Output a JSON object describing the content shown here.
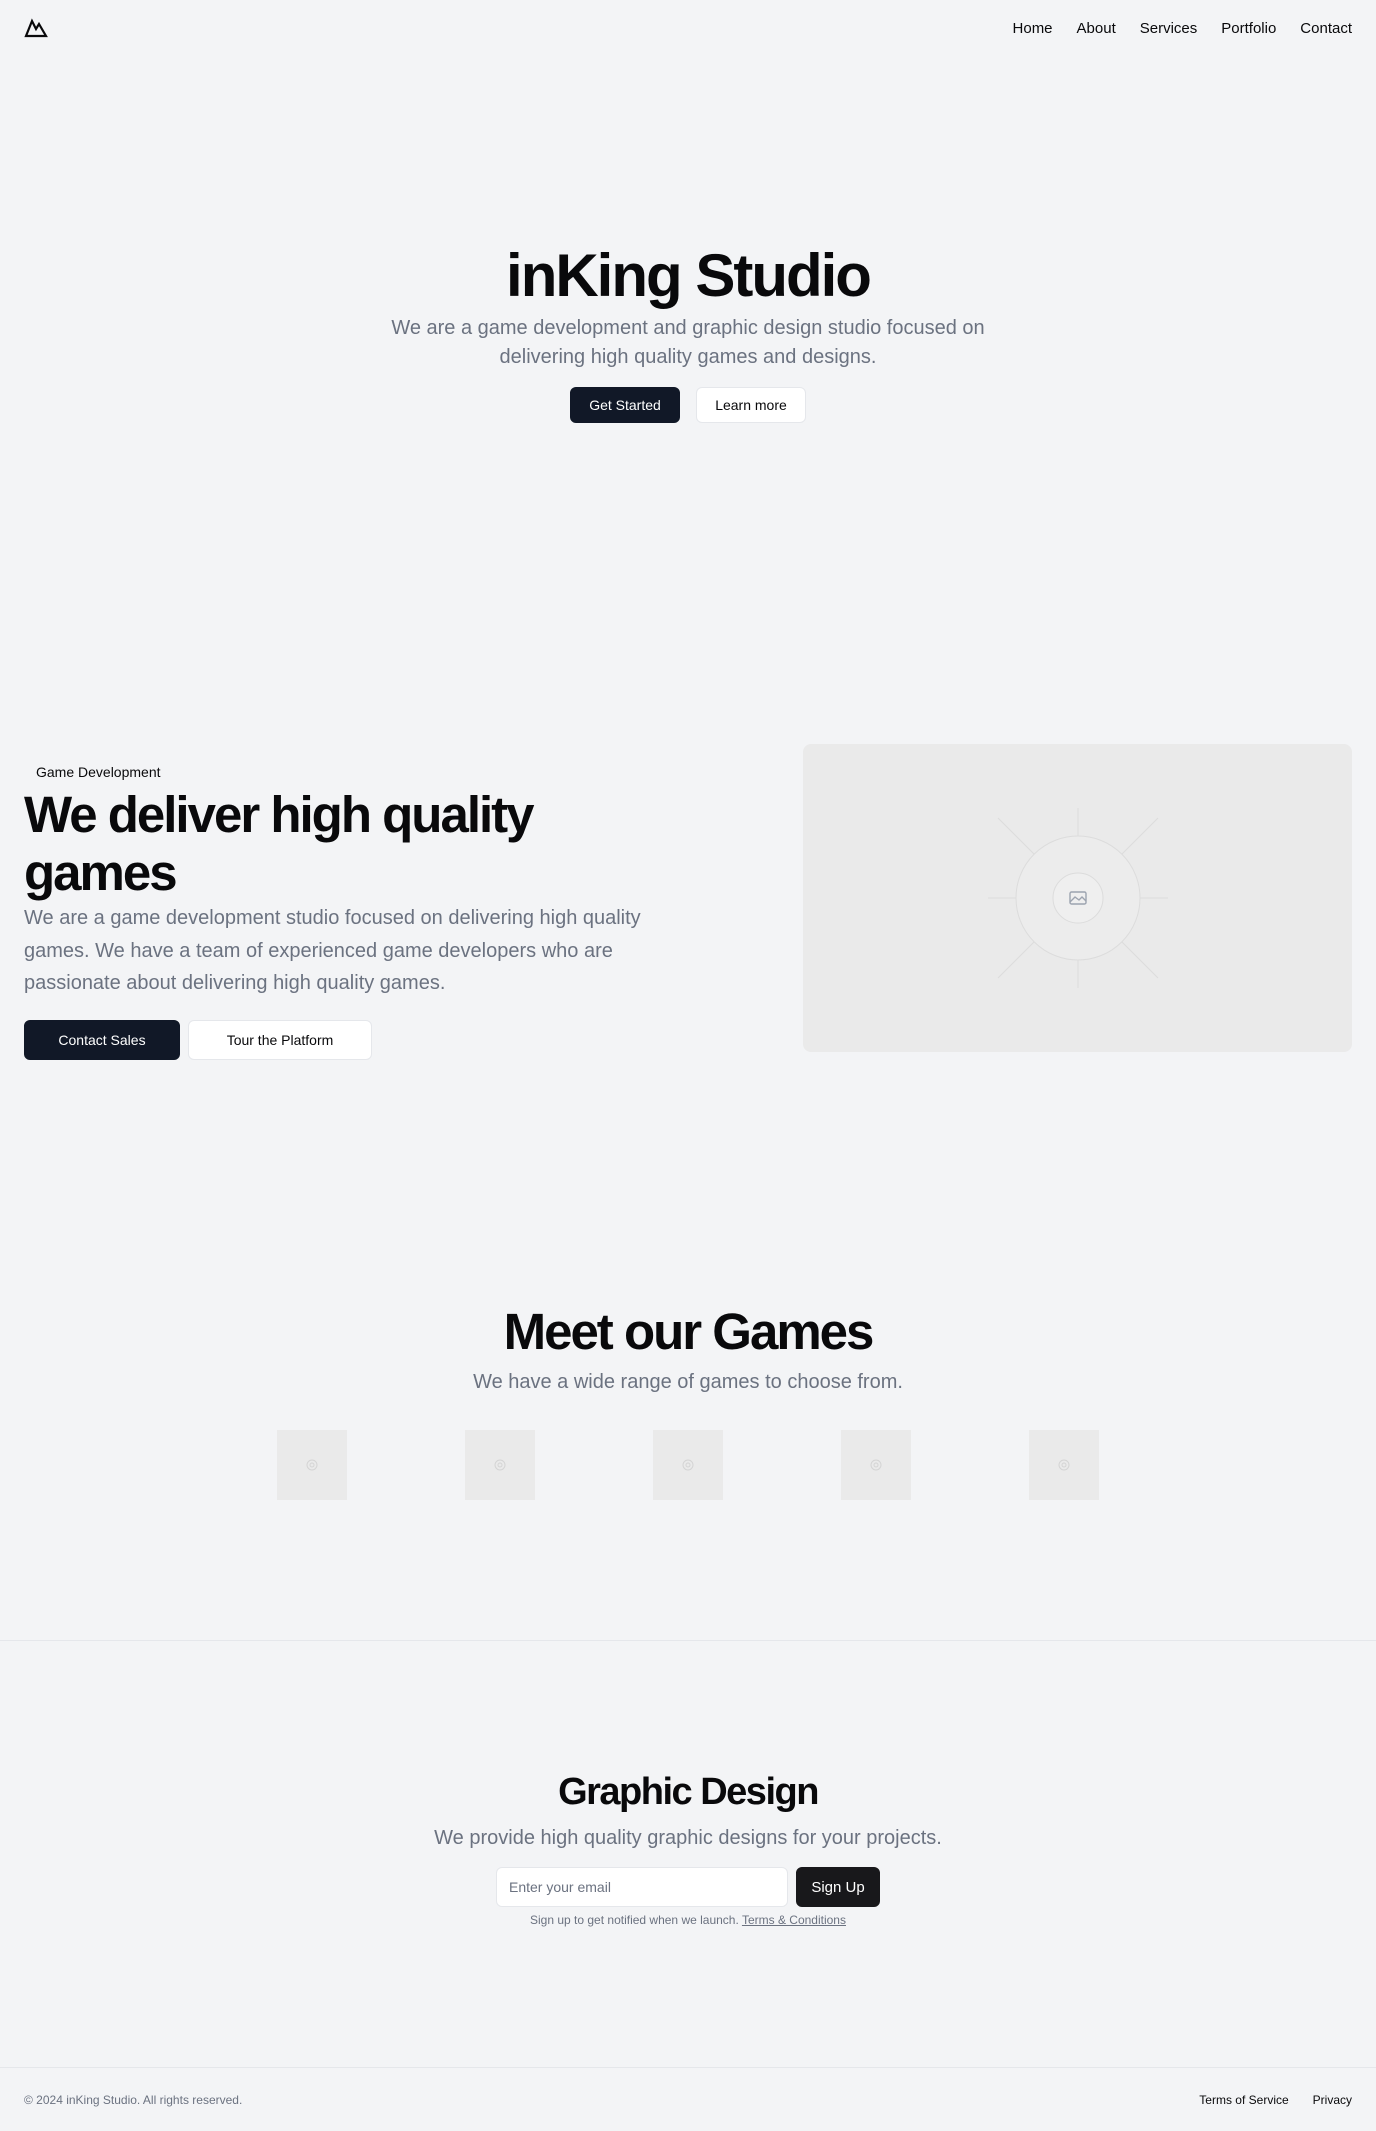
{
  "header": {
    "logo_icon": "mountain-icon",
    "nav": [
      {
        "label": "Home"
      },
      {
        "label": "About"
      },
      {
        "label": "Services"
      },
      {
        "label": "Portfolio"
      },
      {
        "label": "Contact"
      }
    ]
  },
  "hero": {
    "title": "inKing Studio",
    "subtitle": "We are a game development and graphic design studio focused on delivering high quality games and designs.",
    "primary_button": "Get Started",
    "secondary_button": "Learn more"
  },
  "feature": {
    "badge": "Game Development",
    "title": "We deliver high quality games",
    "text": "We are a game development studio focused on delivering high quality games. We have a team of experienced game developers who are passionate about delivering high quality games.",
    "primary_button": "Contact Sales",
    "secondary_button": "Tour the Platform",
    "image_icon": "image-placeholder-icon"
  },
  "games": {
    "title": "Meet our Games",
    "subtitle": "We have a wide range of games to choose from.",
    "thumbnails": [
      {
        "icon": "image-placeholder-icon"
      },
      {
        "icon": "image-placeholder-icon"
      },
      {
        "icon": "image-placeholder-icon"
      },
      {
        "icon": "image-placeholder-icon"
      },
      {
        "icon": "image-placeholder-icon"
      }
    ]
  },
  "design": {
    "title": "Graphic Design",
    "subtitle": "We provide high quality graphic designs for your projects.",
    "email_placeholder": "Enter your email",
    "signup_button": "Sign Up",
    "note": "Sign up to get notified when we launch.",
    "terms_link": "Terms & Conditions"
  },
  "footer": {
    "copyright": "© 2024 inKing Studio. All rights reserved.",
    "links": [
      {
        "label": "Terms of Service"
      },
      {
        "label": "Privacy"
      }
    ]
  },
  "colors": {
    "background": "#f3f4f6",
    "primary": "#111827",
    "muted_text": "#6b7280",
    "placeholder_bg": "#eaeaea"
  }
}
